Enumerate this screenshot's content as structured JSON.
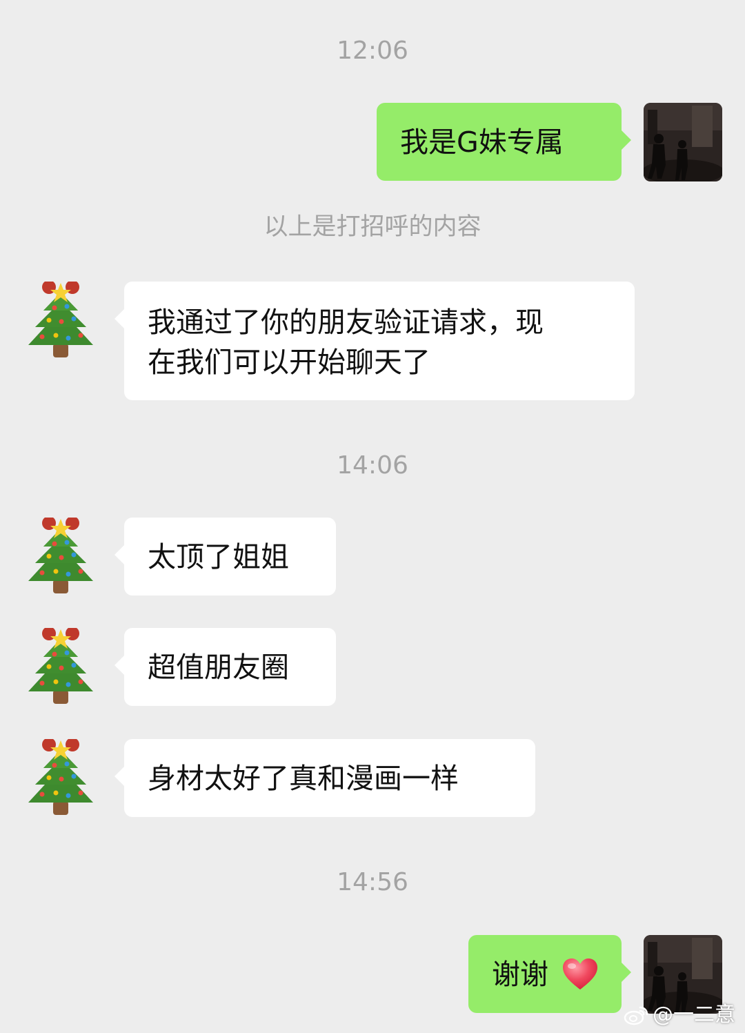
{
  "timestamps": [
    "12:06",
    "14:06",
    "14:56"
  ],
  "system_note": "以上是打招呼的内容",
  "messages": [
    {
      "side": "right",
      "text": "我是G妹专属",
      "avatar": "photo-avatar"
    },
    {
      "side": "left",
      "text": "我通过了你的朋友验证请求，现\n在我们可以开始聊天了",
      "avatar": "christmas-tree-avatar"
    },
    {
      "side": "left",
      "text": "太顶了姐姐",
      "avatar": "christmas-tree-avatar"
    },
    {
      "side": "left",
      "text": "超值朋友圈",
      "avatar": "christmas-tree-avatar"
    },
    {
      "side": "left",
      "text": "身材太好了真和漫画一样",
      "avatar": "christmas-tree-avatar"
    },
    {
      "side": "right",
      "text": "谢谢",
      "emoji": "red-heart",
      "avatar": "photo-avatar"
    }
  ],
  "watermark": "@一二意",
  "colors": {
    "background": "#ededed",
    "bubble_sent": "#95ec69",
    "bubble_received": "#ffffff",
    "meta_text": "#a3a3a3"
  }
}
